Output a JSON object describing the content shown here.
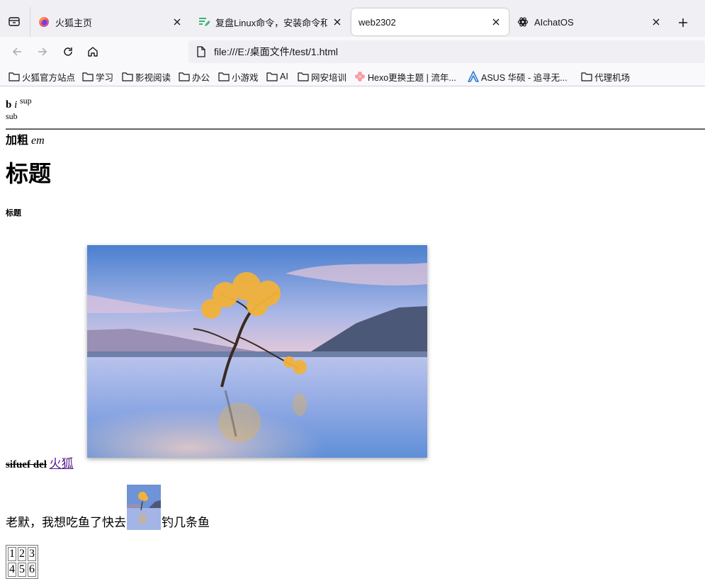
{
  "browser": {
    "tabs": [
      {
        "title": "火狐主页",
        "favicon": "firefox-icon",
        "active": false
      },
      {
        "title": "复盘Linux命令，安装命令和工具",
        "favicon": "edit-note-icon",
        "active": false
      },
      {
        "title": "web2302",
        "favicon": "",
        "active": true
      },
      {
        "title": "AIchatOS",
        "favicon": "openai-icon",
        "active": false
      }
    ],
    "url": "file:///E:/桌面文件/test/1.html",
    "bookmarks": [
      {
        "label": "火狐官方站点",
        "icon": "folder-icon"
      },
      {
        "label": "学习",
        "icon": "folder-icon"
      },
      {
        "label": "影视阅读",
        "icon": "folder-icon"
      },
      {
        "label": "办公",
        "icon": "folder-icon"
      },
      {
        "label": "小游戏",
        "icon": "folder-icon"
      },
      {
        "label": "AI",
        "icon": "folder-icon"
      },
      {
        "label": "网安培训",
        "icon": "folder-icon"
      },
      {
        "label": "Hexo更换主题 | 流年...",
        "icon": "flower-icon"
      },
      {
        "label": "ASUS 华硕 - 追寻无...",
        "icon": "asus-icon"
      },
      {
        "label": "代理机场",
        "icon": "folder-icon"
      }
    ]
  },
  "content": {
    "b_text": "b",
    "i_text": "i",
    "sup_text": "sup",
    "sub_text": "sub",
    "strong_text": "加粗",
    "em_text": "em",
    "h1_text": "标题",
    "h6_text": "标题",
    "del_text": "sifuef del",
    "link_text": "火狐",
    "sentence_before": "老默，我想吃鱼了快去",
    "sentence_after": "钓几条鱼",
    "table_rows": [
      [
        "1",
        "2",
        "3"
      ],
      [
        "4",
        "5",
        "6"
      ]
    ]
  },
  "colors": {
    "link": "#551a8b",
    "tab_strip_bg": "#f0f0f4",
    "toolbar_bg": "#f9f9fb",
    "urlbar_bg": "#f0f0f4"
  }
}
